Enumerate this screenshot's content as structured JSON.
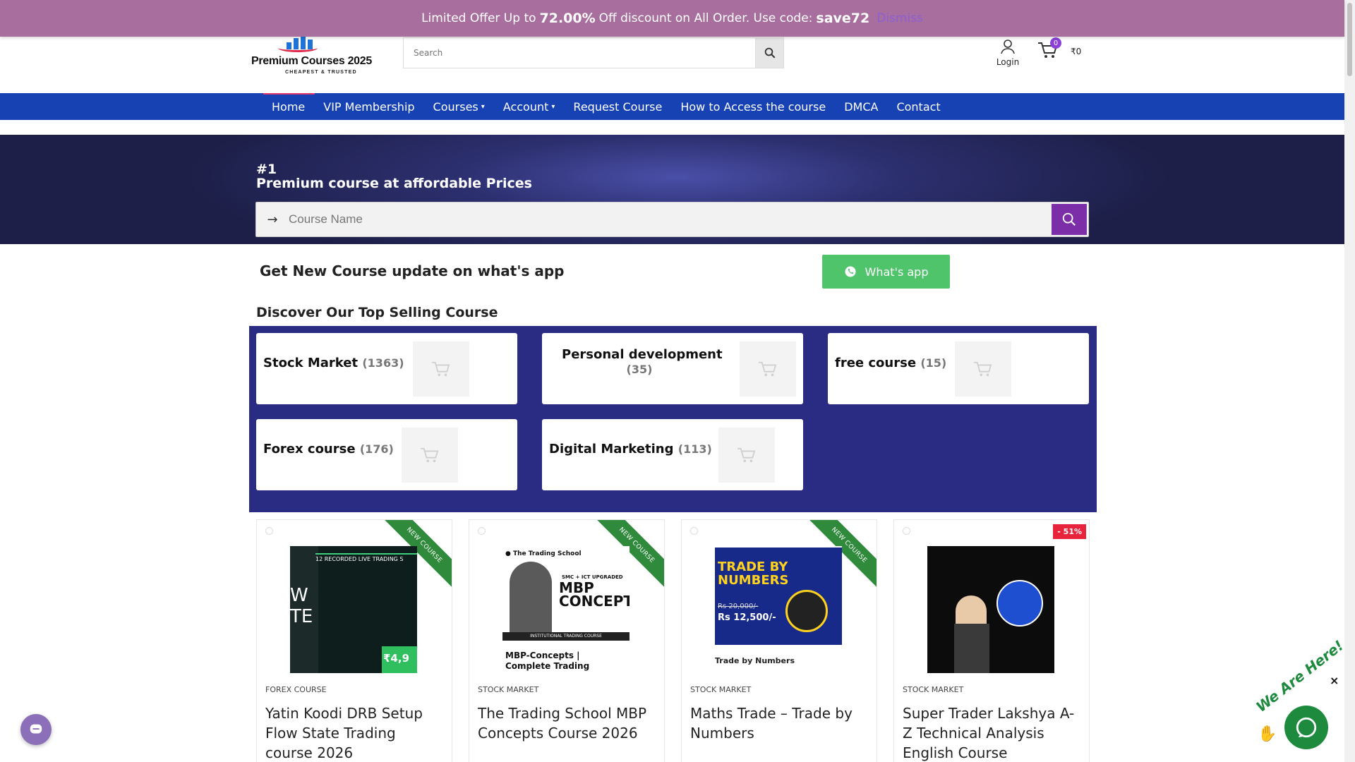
{
  "promo": {
    "prefix": "Limited Offer Up to",
    "percent": "72.00%",
    "middle": "Off discount on All Order. Use code:",
    "code": "save72",
    "dismiss": "Dismiss"
  },
  "header": {
    "logo_name": "Premium Courses 2025",
    "logo_tag": "CHEAPEST & TRUSTED",
    "search_placeholder": "Search",
    "login_label": "Login",
    "cart_count": "0",
    "cart_total": "₹0"
  },
  "nav": {
    "items": [
      {
        "label": "Home"
      },
      {
        "label": "VIP Membership"
      },
      {
        "label": "Courses",
        "chevron": "⌄"
      },
      {
        "label": "Account",
        "chevron": "⌄"
      },
      {
        "label": "Request Course"
      },
      {
        "label": "How to Access the course"
      },
      {
        "label": "DMCA"
      },
      {
        "label": "Contact"
      }
    ]
  },
  "hero": {
    "hash": "#1",
    "headline": "Premium course at affordable Prices",
    "search_placeholder": "Course Name"
  },
  "whatsapp": {
    "text": "Get New Course update on what's app",
    "button": "What's app"
  },
  "discover_title": "Discover Our Top Selling Course",
  "categories": [
    {
      "name": "Stock Market",
      "count": "(1363)"
    },
    {
      "name": "Personal development",
      "count": "(35)"
    },
    {
      "name": "free course",
      "count": "(15)"
    },
    {
      "name": "Forex course",
      "count": "(176)"
    },
    {
      "name": "Digital Marketing",
      "count": "(113)"
    }
  ],
  "products": [
    {
      "category": "FOREX COURSE",
      "title": "Yatin Koodi DRB Setup Flow State Trading course 2026",
      "ribbon": "NEW COURSE",
      "img_text": "12 RECORDED LIVE TRADING S",
      "img_price": "₹4,9"
    },
    {
      "category": "STOCK MARKET",
      "title": "The Trading School MBP Concepts Course 2026",
      "ribbon": "NEW COURSE",
      "img_brand": "The Trading School",
      "img_big": "MBP CONCEPT",
      "img_sub": "SMC + ICT UPGRADED",
      "img_caption": "MBP-Concepts | Complete Trading Course",
      "img_band": "INSTITUTIONAL TRADING COURSE"
    },
    {
      "category": "STOCK MARKET",
      "title": "Maths Trade – Trade by Numbers",
      "ribbon": "NEW COURSE",
      "img_big": "TRADE BY NUMBERS",
      "img_old_price": "Rs 20,000/-",
      "img_price": "Rs 12,500/-",
      "img_caption": "Trade by Numbers"
    },
    {
      "category": "STOCK MARKET",
      "title": "Super Trader Lakshya A-Z Technical Analysis English Course",
      "sale": "- 51%"
    }
  ],
  "floating": {
    "we_are_here": "We Are Here!",
    "close": "×"
  },
  "colors": {
    "promo": "#a86f9e",
    "nav": "#1642b4",
    "category_panel": "#2a2b82",
    "accent_purple": "#7b2ea8",
    "whatsapp_green": "#4fc46b"
  }
}
